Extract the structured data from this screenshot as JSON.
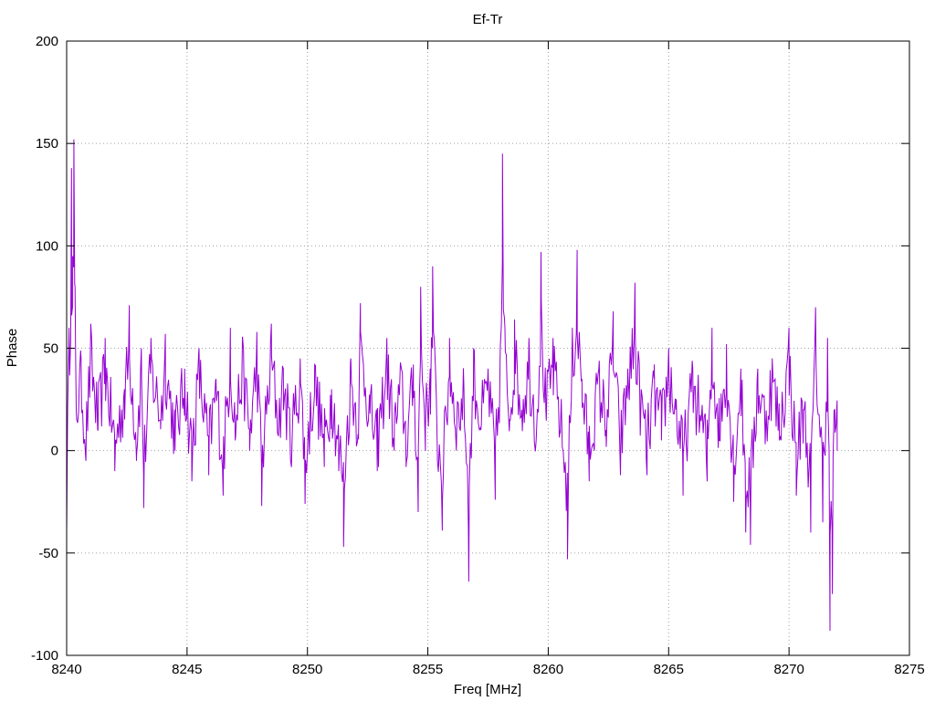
{
  "chart_data": {
    "type": "line",
    "title": "Ef-Tr",
    "xlabel": "Freq [MHz]",
    "ylabel": "Phase",
    "xlim": [
      8240,
      8275
    ],
    "ylim": [
      -100,
      200
    ],
    "xticks": [
      8240,
      8245,
      8250,
      8255,
      8260,
      8265,
      8270,
      8275
    ],
    "yticks": [
      -100,
      -50,
      0,
      50,
      100,
      150,
      200
    ],
    "grid": true,
    "legend": "none",
    "series": [
      {
        "color": "#9400d3",
        "x_start": 8240.0,
        "x_step": 0.0415,
        "anchors": [
          [
            8240.0,
            -40
          ],
          [
            8240.1,
            60
          ],
          [
            8240.2,
            138
          ],
          [
            8240.25,
            95
          ],
          [
            8240.3,
            152
          ],
          [
            8240.35,
            80
          ],
          [
            8240.4,
            20
          ],
          [
            8240.6,
            45
          ],
          [
            8240.8,
            -5
          ],
          [
            8241.0,
            62
          ],
          [
            8241.3,
            10
          ],
          [
            8241.6,
            55
          ],
          [
            8242.0,
            -10
          ],
          [
            8242.4,
            30
          ],
          [
            8242.6,
            71
          ],
          [
            8242.9,
            -5
          ],
          [
            8243.1,
            50
          ],
          [
            8243.2,
            -28
          ],
          [
            8243.5,
            55
          ],
          [
            8243.9,
            15
          ],
          [
            8244.1,
            57
          ],
          [
            8244.5,
            0
          ],
          [
            8244.9,
            40
          ],
          [
            8245.2,
            -15
          ],
          [
            8245.5,
            50
          ],
          [
            8245.9,
            -12
          ],
          [
            8246.2,
            35
          ],
          [
            8246.5,
            -22
          ],
          [
            8246.8,
            60
          ],
          [
            8247.0,
            5
          ],
          [
            8247.3,
            55
          ],
          [
            8247.6,
            0
          ],
          [
            8247.9,
            58
          ],
          [
            8248.1,
            -27
          ],
          [
            8248.5,
            62
          ],
          [
            8248.8,
            10
          ],
          [
            8249.0,
            40
          ],
          [
            8249.3,
            -5
          ],
          [
            8249.7,
            45
          ],
          [
            8249.9,
            -26
          ],
          [
            8250.3,
            42
          ],
          [
            8250.7,
            -8
          ],
          [
            8251.0,
            30
          ],
          [
            8251.3,
            -10
          ],
          [
            8251.5,
            -47
          ],
          [
            8251.8,
            45
          ],
          [
            8252.1,
            8
          ],
          [
            8252.2,
            72
          ],
          [
            8252.6,
            18
          ],
          [
            8252.9,
            -10
          ],
          [
            8253.3,
            55
          ],
          [
            8253.6,
            0
          ],
          [
            8253.9,
            40
          ],
          [
            8254.1,
            -8
          ],
          [
            8254.4,
            42
          ],
          [
            8254.6,
            -30
          ],
          [
            8254.7,
            80
          ],
          [
            8254.9,
            10
          ],
          [
            8255.1,
            40
          ],
          [
            8255.2,
            90
          ],
          [
            8255.4,
            -5
          ],
          [
            8255.6,
            -39
          ],
          [
            8255.9,
            55
          ],
          [
            8256.2,
            10
          ],
          [
            8256.5,
            30
          ],
          [
            8256.7,
            -64
          ],
          [
            8256.9,
            50
          ],
          [
            8257.2,
            10
          ],
          [
            8257.5,
            40
          ],
          [
            8257.8,
            -24
          ],
          [
            8258.0,
            45
          ],
          [
            8258.1,
            145
          ],
          [
            8258.2,
            60
          ],
          [
            8258.4,
            15
          ],
          [
            8258.6,
            64
          ],
          [
            8258.9,
            20
          ],
          [
            8259.2,
            55
          ],
          [
            8259.5,
            5
          ],
          [
            8259.7,
            97
          ],
          [
            8259.9,
            20
          ],
          [
            8260.2,
            55
          ],
          [
            8260.5,
            10
          ],
          [
            8260.8,
            -53
          ],
          [
            8261.0,
            60
          ],
          [
            8261.2,
            98
          ],
          [
            8261.4,
            35
          ],
          [
            8261.7,
            -15
          ],
          [
            8262.1,
            40
          ],
          [
            8262.4,
            10
          ],
          [
            8262.7,
            68
          ],
          [
            8263.0,
            -12
          ],
          [
            8263.3,
            40
          ],
          [
            8263.6,
            82
          ],
          [
            8263.8,
            30
          ],
          [
            8264.1,
            -12
          ],
          [
            8264.4,
            35
          ],
          [
            8264.7,
            5
          ],
          [
            8265.0,
            50
          ],
          [
            8265.3,
            20
          ],
          [
            8265.6,
            -22
          ],
          [
            8266.0,
            40
          ],
          [
            8266.3,
            15
          ],
          [
            8266.6,
            -15
          ],
          [
            8266.8,
            60
          ],
          [
            8267.1,
            5
          ],
          [
            8267.4,
            52
          ],
          [
            8267.7,
            -25
          ],
          [
            8268.0,
            40
          ],
          [
            8268.2,
            -40
          ],
          [
            8268.4,
            -46
          ],
          [
            8268.7,
            40
          ],
          [
            8269.0,
            10
          ],
          [
            8269.3,
            45
          ],
          [
            8269.6,
            5
          ],
          [
            8270.0,
            60
          ],
          [
            8270.3,
            -22
          ],
          [
            8270.6,
            20
          ],
          [
            8270.9,
            -40
          ],
          [
            8271.1,
            70
          ],
          [
            8271.4,
            -35
          ],
          [
            8271.6,
            55
          ],
          [
            8271.7,
            -88
          ],
          [
            8271.8,
            -70
          ],
          [
            8271.9,
            20
          ],
          [
            8272.0,
            0
          ]
        ]
      }
    ]
  }
}
